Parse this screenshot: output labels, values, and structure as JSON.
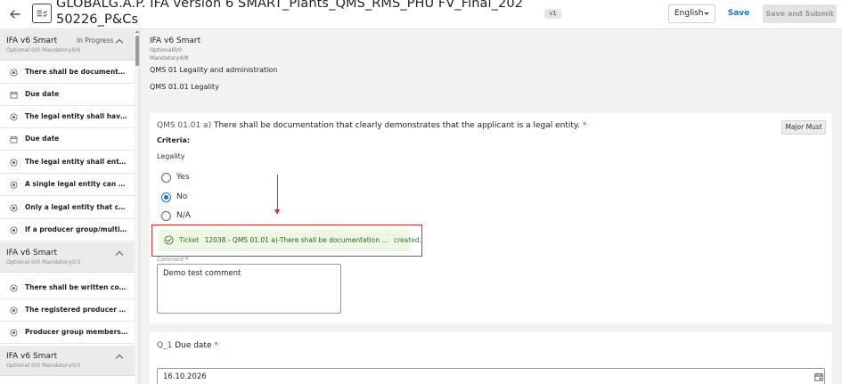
{
  "header": {
    "title": "GLOBALG.A.P. IFA version 6 SMART_Plants_QMS_RMS_PHU FV_Final_20250226_P&Cs",
    "version": "v1",
    "language": "English",
    "save_label": "Save",
    "submit_label": "Save and Submit"
  },
  "sidebar": {
    "sections": [
      {
        "title": "IFA v6 Smart",
        "status": "In Progress",
        "sub": "Optional 0/0   Mandatory4/8",
        "items": [
          {
            "icon": "radio-target-icon",
            "label": "There shall be documentatio..."
          },
          {
            "icon": "calendar-icon",
            "label": "Due date"
          },
          {
            "icon": "radio-target-icon",
            "label": "The legal entity shall have be..."
          },
          {
            "icon": "calendar-icon",
            "label": "Due date"
          },
          {
            "icon": "radio-target-icon",
            "label": "The legal entity shall enter in..."
          },
          {
            "icon": "radio-target-icon",
            "label": "A single legal entity can only ..."
          },
          {
            "icon": "radio-target-icon",
            "label": "Only a legal entity that can b..."
          },
          {
            "icon": "radio-target-icon",
            "label": "If a producer group/multisite..."
          }
        ]
      },
      {
        "title": "IFA v6 Smart",
        "sub": "Optional 0/0   Mandatory0/3",
        "items": [
          {
            "icon": "radio-target-icon",
            "label": "There shall be written contra..."
          },
          {
            "icon": "radio-target-icon",
            "label": "The registered producer gro..."
          },
          {
            "icon": "radio-target-icon",
            "label": "Producer group members ar..."
          }
        ]
      },
      {
        "title": "IFA v6 Smart",
        "sub": "Optional 0/0   Mandatory0/3",
        "items": []
      }
    ]
  },
  "main": {
    "crumb_title": "IFA v6 Smart",
    "crumb_optional": "Optional0/0",
    "crumb_mandatory": "Mandatory4/8",
    "section": "QMS 01 Legality and administration",
    "subsection": "QMS 01.01 Legality",
    "question": {
      "code": "QMS 01.01 a)",
      "text": "There shall be documentation that clearly demonstrates that the applicant is a legal entity.",
      "required": "*",
      "badge": "Major Must",
      "criteria_label": "Criteria:",
      "criteria_value": "Legality",
      "options": [
        {
          "label": "Yes",
          "checked": false
        },
        {
          "label": "No",
          "checked": true
        },
        {
          "label": "N/A",
          "checked": false
        }
      ],
      "comment_label": "Comment",
      "comment_value": "Demo test comment"
    },
    "toast": {
      "prefix": "Ticket",
      "ticket_id": "12038 - QMS 01.01 a)-There shall be documentation ...",
      "suffix": "created."
    },
    "question2": {
      "code": "Q_1",
      "text": "Due date",
      "required": "*",
      "date_value": "16.10.2026"
    }
  },
  "colors": {
    "accent": "#1a73c9",
    "required": "#d32f2f",
    "toast_bg": "#eef6e4",
    "toast_text": "#3e7a24"
  }
}
